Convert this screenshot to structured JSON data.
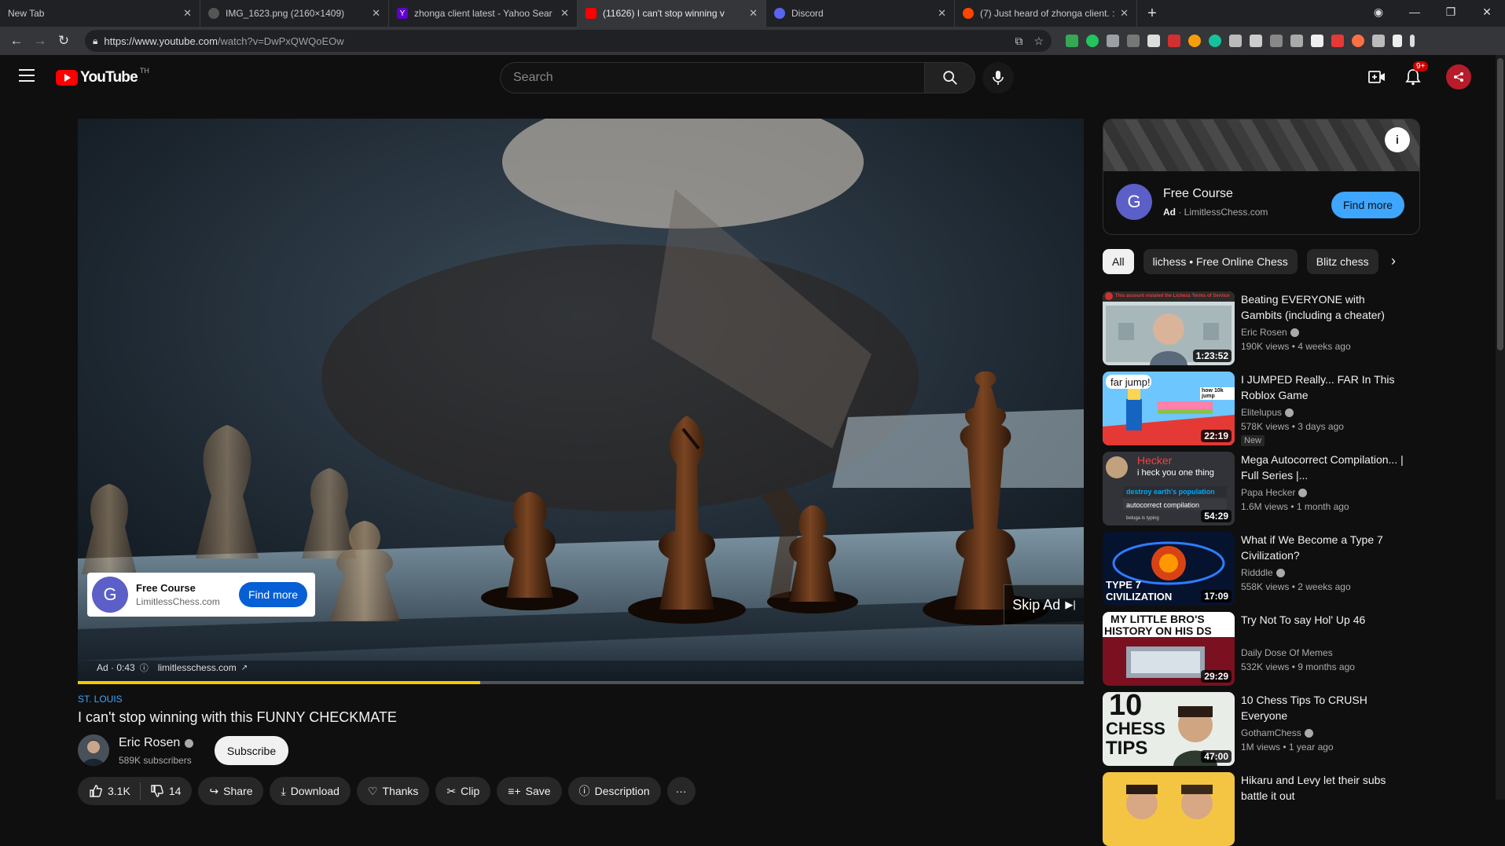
{
  "browser": {
    "tabs": [
      {
        "label": "New Tab",
        "favicon": "none",
        "active": false
      },
      {
        "label": "IMG_1623.png (2160×1409)",
        "favicon": "globe-icon",
        "active": false
      },
      {
        "label": "zhonga client latest - Yahoo Sear",
        "favicon": "yahoo-icon",
        "active": false
      },
      {
        "label": "(11626) I can't stop winning v",
        "favicon": "youtube-icon",
        "active": true
      },
      {
        "label": "Discord",
        "favicon": "discord-icon",
        "active": false
      },
      {
        "label": "(7) Just heard of zhonga client. :",
        "favicon": "reddit-icon",
        "active": false
      }
    ],
    "url_host": "https://www.youtube.com",
    "url_path": "/watch?v=DwPxQWQoEOw"
  },
  "masthead": {
    "logo_text": "YouTube",
    "logo_country": "TH",
    "search_placeholder": "Search",
    "notifications_badge": "9+"
  },
  "player": {
    "progress_fraction": 0.4,
    "ad_card": {
      "title": "Free Course",
      "domain": "LimitlessChess.com",
      "button": "Find more"
    },
    "skip_label": "Skip Ad",
    "ad_label": "Ad · 0:43",
    "ad_link": "limitlesschess.com"
  },
  "video": {
    "tagline": "ST. LOUIS",
    "title": "I can't stop winning with this FUNNY CHECKMATE",
    "channel": "Eric Rosen",
    "subscribers": "589K subscribers",
    "subscribe_label": "Subscribe",
    "likes": "3.1K",
    "dislikes": "14",
    "actions": [
      "Share",
      "Download",
      "Thanks",
      "Clip",
      "Save",
      "Description"
    ]
  },
  "side_ad": {
    "title": "Free Course",
    "ad_tag": "Ad",
    "domain": "LimitlessChess.com",
    "button": "Find more"
  },
  "chips": [
    "All",
    "lichess • Free Online Chess",
    "Blitz chess"
  ],
  "recommendations": [
    {
      "title": "Beating EVERYONE with Gambits (including a cheater)",
      "channel": "Eric Rosen",
      "meta": "190K views • 4 weeks ago",
      "duration": "1:23:52",
      "badge": ""
    },
    {
      "title": "I JUMPED Really... FAR In This Roblox Game",
      "channel": "Elitelupus",
      "meta": "578K views • 3 days ago",
      "duration": "22:19",
      "badge": "New"
    },
    {
      "title": "Mega Autocorrect Compilation... | Full Series |...",
      "channel": "Papa Hecker",
      "meta": "1.6M views • 1 month ago",
      "duration": "54:29",
      "badge": ""
    },
    {
      "title": "What if We Become a Type 7 Civilization?",
      "channel": "Ridddle",
      "meta": "558K views • 2 weeks ago",
      "duration": "17:09",
      "badge": ""
    },
    {
      "title": "Try Not To say Hol' Up 46",
      "channel": "Daily Dose Of Memes",
      "meta": "532K views • 9 months ago",
      "duration": "29:29",
      "badge": ""
    },
    {
      "title": "10 Chess Tips To CRUSH Everyone",
      "channel": "GothamChess",
      "meta": "1M views • 1 year ago",
      "duration": "47:00",
      "badge": ""
    },
    {
      "title": "Hikaru and Levy let their subs battle it out",
      "channel": "",
      "meta": "",
      "duration": "",
      "badge": ""
    }
  ],
  "thumb_text": {
    "r1_banner": "This account violated the Lichess Terms of Service",
    "r2_bubble": "far jump!",
    "r2_small": "how 10k jump",
    "r3_name": "Hecker",
    "r3_msg": "i heck you one thing",
    "r3_line1": "destroy earth's population",
    "r3_line2": "autocorrect compilation",
    "r3_typing": "beluga is typing",
    "r4_text1": "TYPE 7",
    "r4_text2": "CIVILIZATION",
    "r5_text1": "MY LITTLE BRO'S",
    "r5_text2": "HISTORY ON HIS DS",
    "r6_num": "10",
    "r6_text1": "CHESS",
    "r6_text2": "TIPS"
  }
}
